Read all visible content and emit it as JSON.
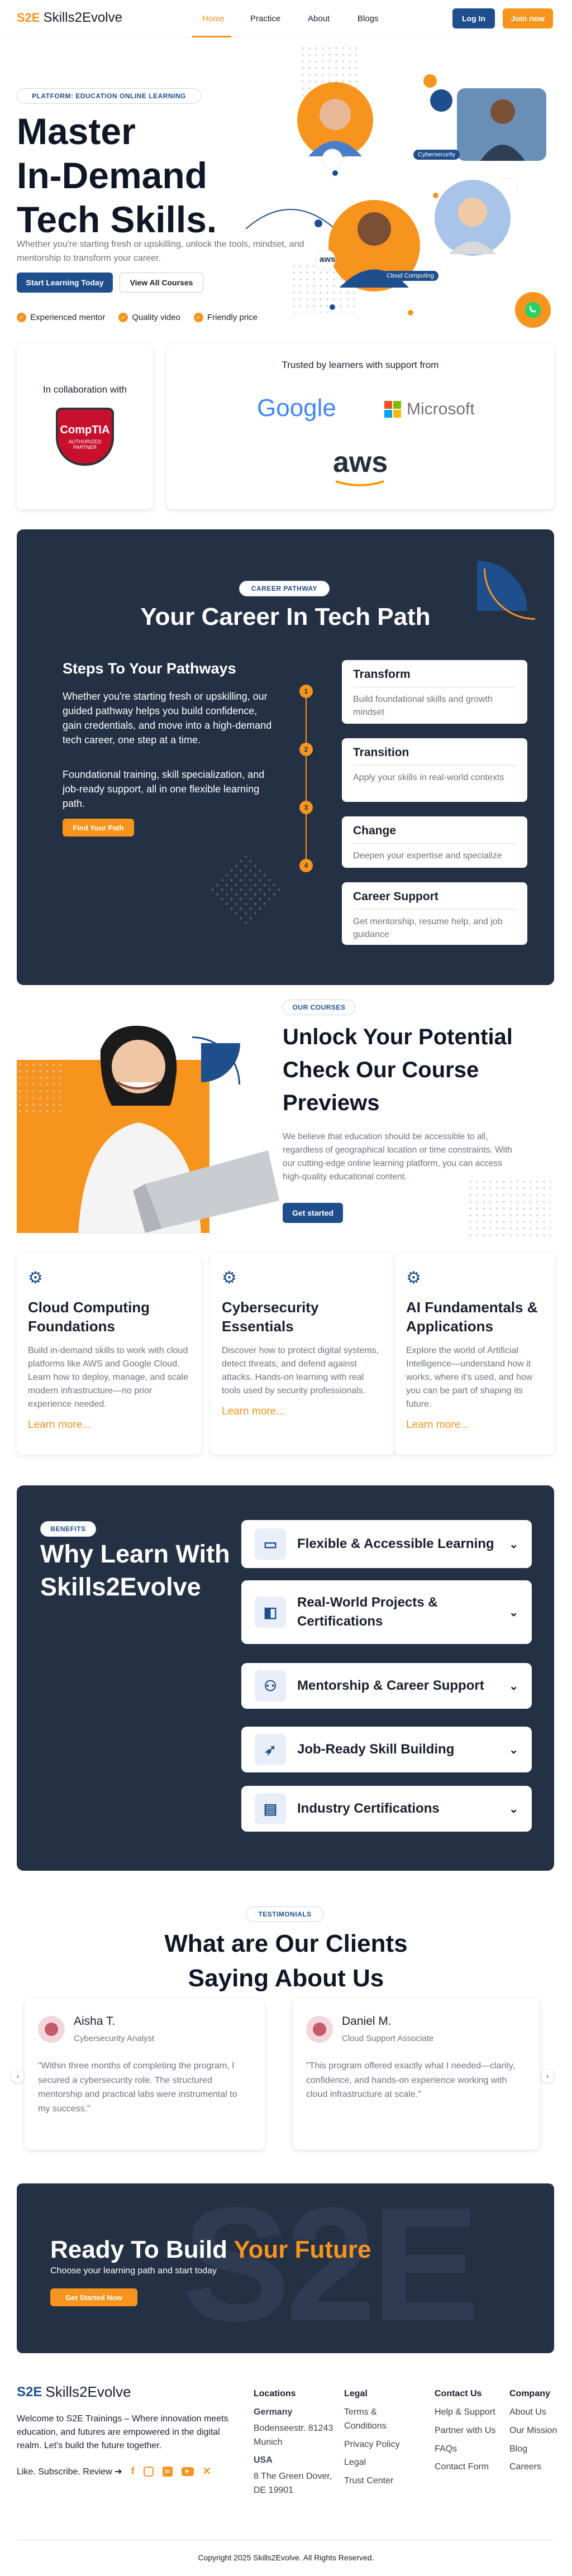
{
  "nav": {
    "logo_mark": "S2E",
    "logo_text": "Skills2Evolve",
    "links": [
      "Home",
      "Practice",
      "About",
      "Blogs"
    ],
    "login": "Log In",
    "join": "Join now"
  },
  "hero": {
    "badge": "PLATFORM: EDUCATION ONLINE LEARNING",
    "title_lines": [
      "Master",
      "In-Demand",
      "Tech Skills."
    ],
    "desc": "Whether you're starting fresh or upskilling, unlock the tools, mindset, and mentorship to transform your career.",
    "cta_primary": "Start Learning Today",
    "cta_secondary": "View All Courses",
    "features": [
      "Experienced mentor",
      "Quality video",
      "Friendly price"
    ],
    "float_labels": {
      "cyber": "Cybersecurity",
      "cloud": "Cloud Computing",
      "aws": "aws"
    }
  },
  "partners": {
    "collab": "In collaboration with",
    "comptia_name": "CompTIA",
    "comptia_sub": "AUTHORIZED PARTNER",
    "trusted": "Trusted by learners with support from",
    "google": "Google",
    "microsoft": "Microsoft",
    "aws": "aws"
  },
  "pathway": {
    "badge": "CAREER PATHWAY",
    "title": "Your Career In Tech Path",
    "steps_title": "Steps To Your Pathways",
    "p1": "Whether you're starting fresh or upskilling, our guided pathway helps you build confidence, gain credentials, and move into a high-demand tech career, one step at a time.",
    "p2": "Foundational training, skill specialization, and job-ready support, all in one flexible learning path.",
    "cta": "Find Your Path",
    "step_nums": [
      "1",
      "2",
      "3",
      "4"
    ],
    "cards": [
      {
        "title": "Transform",
        "desc": "Build foundational skills and growth mindset"
      },
      {
        "title": "Transition",
        "desc": "Apply your skills in real-world contexts"
      },
      {
        "title": "Change",
        "desc": "Deepen your expertise and specialize"
      },
      {
        "title": "Career Support",
        "desc": "Get mentorship, resume help, and job guidance"
      }
    ]
  },
  "courses": {
    "badge": "OUR COURSES",
    "title_lines": [
      "Unlock Your Potential",
      "Check Our Course",
      "Previews"
    ],
    "desc": "We believe that education should be accessible to all, regardless of geographical location or time constraints. With our cutting-edge online learning platform, you can access high-quality educational content.",
    "cta": "Get started",
    "items": [
      {
        "title": "Cloud Computing Foundations",
        "desc": "Build in-demand skills to work with cloud platforms like AWS and Google Cloud. Learn how to deploy, manage, and scale modern infrastructure—no prior experience needed.",
        "link": "Learn more..."
      },
      {
        "title": "Cybersecurity Essentials",
        "desc": "Discover how to protect digital systems, detect threats, and defend against attacks. Hands-on learning with real tools used by security professionals.",
        "link": "Learn more..."
      },
      {
        "title": "AI Fundamentals & Applications",
        "desc": "Explore the world of Artificial Intelligence—understand how it works, where it's used, and how you can be part of shaping its future.",
        "link": "Learn more..."
      }
    ]
  },
  "benefits": {
    "badge": "BENEFITS",
    "title_lines": [
      "Why Learn With",
      "Skills2Evolve"
    ],
    "items": [
      "Flexible & Accessible Learning",
      "Real-World Projects & Certifications",
      "Mentorship & Career Support",
      "Job-Ready Skill Building",
      "Industry Certifications"
    ]
  },
  "testimonials": {
    "badge": "TESTIMONIALS",
    "title_lines": [
      "What are Our Clients",
      "Saying About Us"
    ],
    "items": [
      {
        "name": "Aisha T.",
        "role": "Cybersecurity Analyst",
        "quote": "\"Within three months of completing the program, I secured a cybersecurity role. The structured mentorship and practical labs were instrumental to my success.\""
      },
      {
        "name": "Daniel M.",
        "role": "Cloud Support Associate",
        "quote": "\"This program offered exactly what I needed—clarity, confidence, and hands-on experience working with cloud infrastructure at scale.\""
      }
    ]
  },
  "cta": {
    "title_a": "Ready To Build ",
    "title_b": "Your Future",
    "sub": "Choose your learning path and start today",
    "button": "Get Started Now",
    "watermark": "S2E"
  },
  "footer": {
    "about": "Welcome to S2E Trainings – Where innovation meets education, and futures are empowered in the digital realm. Let's build the future together.",
    "social_label": "Like. Subscribe. Review ➔",
    "locations": {
      "title": "Locations",
      "germany": "Germany",
      "germany_addr": "Bodenseestr. 81243 Munich",
      "usa": "USA",
      "usa_addr": "8 The Green Dover, DE 19901"
    },
    "legal": {
      "title": "Legal",
      "items": [
        "Terms & Conditions",
        "Privacy Policy",
        "Legal",
        "Trust Center"
      ]
    },
    "contact": {
      "title": "Contact Us",
      "items": [
        "Help & Support",
        "Partner with Us",
        "FAQs",
        "Contact Form"
      ]
    },
    "company": {
      "title": "Company",
      "items": [
        "About Us",
        "Our Mission",
        "Blog",
        "Careers"
      ]
    },
    "copyright": "Copyright 2025 Skills2Evolve. All Rights Reserved."
  },
  "colors": {
    "accent": "#f7941d",
    "navy": "#243044",
    "blue": "#1f4e8c"
  }
}
